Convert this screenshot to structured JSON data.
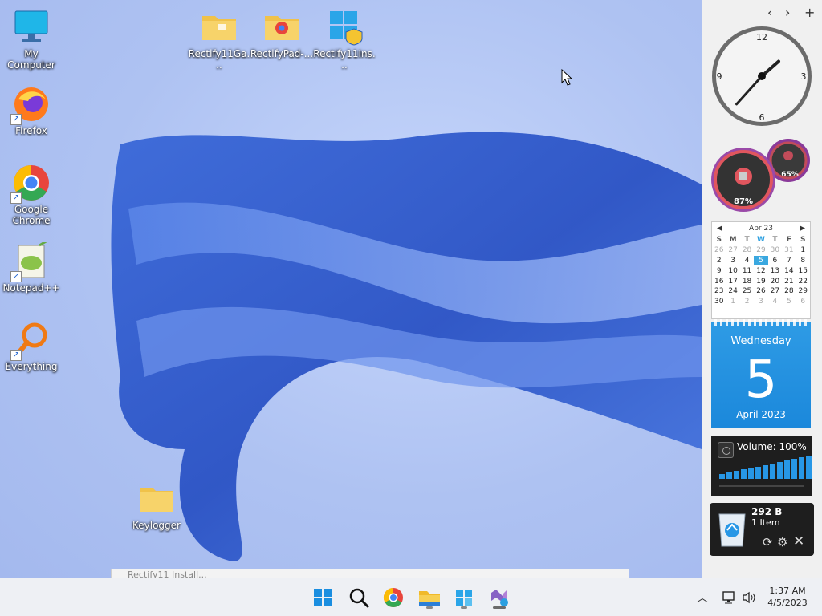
{
  "desktop": {
    "icons": [
      {
        "label": "My Computer",
        "icon": "monitor-icon"
      },
      {
        "label": "Firefox",
        "icon": "firefox-icon"
      },
      {
        "label": "Google Chrome",
        "icon": "chrome-icon"
      },
      {
        "label": "Notepad++",
        "icon": "notepadpp-icon"
      },
      {
        "label": "Everything",
        "icon": "magnifier-icon"
      },
      {
        "label": "Rectify11Ga...",
        "icon": "folder-icon"
      },
      {
        "label": "RectifyPad-...",
        "icon": "folder-chrome-icon"
      },
      {
        "label": "Rectify11Ins...",
        "icon": "installer-icon"
      },
      {
        "label": "Keylogger",
        "icon": "folder-icon"
      }
    ],
    "peek_window_title": "Rectify11 Install..."
  },
  "sidebar": {
    "nav": {
      "prev": "‹",
      "next": "›",
      "add": "+"
    },
    "clock": {
      "n12": "12",
      "n3": "3",
      "n6": "6",
      "n9": "9",
      "hour": 1,
      "minute": 37
    },
    "meters": {
      "cpu": "87%",
      "ram": "65%"
    },
    "mini_calendar": {
      "month": "Apr 23",
      "weekdays": [
        "S",
        "M",
        "T",
        "W",
        "T",
        "F",
        "S"
      ],
      "weeks": [
        [
          "26",
          "27",
          "28",
          "29",
          "30",
          "31",
          "1"
        ],
        [
          "2",
          "3",
          "4",
          "5",
          "6",
          "7",
          "8"
        ],
        [
          "9",
          "10",
          "11",
          "12",
          "13",
          "14",
          "15"
        ],
        [
          "16",
          "17",
          "18",
          "19",
          "20",
          "21",
          "22"
        ],
        [
          "23",
          "24",
          "25",
          "26",
          "27",
          "28",
          "29"
        ],
        [
          "30",
          "1",
          "2",
          "3",
          "4",
          "5",
          "6"
        ]
      ],
      "today": "5"
    },
    "big_calendar": {
      "weekday": "Wednesday",
      "day": "5",
      "month_year": "April 2023"
    },
    "volume": {
      "label": "Volume: 100%",
      "level": 100
    },
    "recycle_bin": {
      "size": "292 B",
      "items": "1 Item"
    }
  },
  "taskbar": {
    "pinned": [
      "start-icon",
      "search-icon",
      "chrome-icon",
      "file-explorer-icon",
      "rectify-installer-icon",
      "visual-studio-icon"
    ],
    "time": "1:37 AM",
    "date": "4/5/2023"
  },
  "colors": {
    "accent": "#2797e6",
    "meter_ring": "#c24c5a",
    "calendar_blue": "#1b88db"
  }
}
